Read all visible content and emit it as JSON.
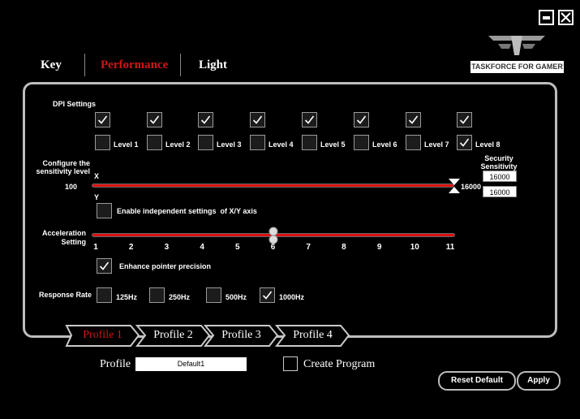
{
  "nav": {
    "tabs": [
      {
        "label": "Key"
      },
      {
        "label": "Performance"
      },
      {
        "label": "Light"
      }
    ]
  },
  "brand": {
    "name": "TASKFORCE FOR GAMER"
  },
  "dpi": {
    "title": "DPI Settings",
    "levels": [
      {
        "label": "Level 1",
        "enabled": true,
        "selected": false
      },
      {
        "label": "Level 2",
        "enabled": true,
        "selected": false
      },
      {
        "label": "Level 3",
        "enabled": true,
        "selected": false
      },
      {
        "label": "Level 4",
        "enabled": true,
        "selected": false
      },
      {
        "label": "Level 5",
        "enabled": true,
        "selected": false
      },
      {
        "label": "Level 6",
        "enabled": true,
        "selected": false
      },
      {
        "label": "Level 7",
        "enabled": true,
        "selected": false
      },
      {
        "label": "Level 8",
        "enabled": true,
        "selected": true
      }
    ]
  },
  "sensitivity": {
    "title": "Configure the\nsensitivity level",
    "x_label": "X",
    "y_label": "Y",
    "min_label": "100",
    "max_label": "16000",
    "value_fraction": 1.0,
    "security_title": "Security\nSensitivity",
    "x_value": "16000",
    "y_value": "16000",
    "independent_label": "Enable independent settings  of X/Y axis",
    "independent_checked": false
  },
  "acceleration": {
    "title": "Acceleration\nSetting",
    "ticks": [
      "1",
      "2",
      "3",
      "4",
      "5",
      "6",
      "7",
      "8",
      "9",
      "10",
      "11"
    ],
    "value": 6,
    "precision_label": "Enhance pointer precision",
    "precision_checked": true
  },
  "response": {
    "title": "Response Rate",
    "options": [
      {
        "label": "125Hz",
        "checked": false
      },
      {
        "label": "250Hz",
        "checked": false
      },
      {
        "label": "500Hz",
        "checked": false
      },
      {
        "label": "1000Hz",
        "checked": true
      }
    ]
  },
  "profiles": {
    "tabs": [
      {
        "label": "Profile 1",
        "active": true
      },
      {
        "label": "Profile 2",
        "active": false
      },
      {
        "label": "Profile 3",
        "active": false
      },
      {
        "label": "Profile 4",
        "active": false
      }
    ],
    "profile_label": "Profile",
    "profile_name": "Default1",
    "create_program_label": "Create Program"
  },
  "actions": {
    "reset_label": "Reset Default",
    "apply_label": "Apply"
  },
  "colors": {
    "accent": "#d01515",
    "inactive_tab_text": "#ffffff"
  }
}
